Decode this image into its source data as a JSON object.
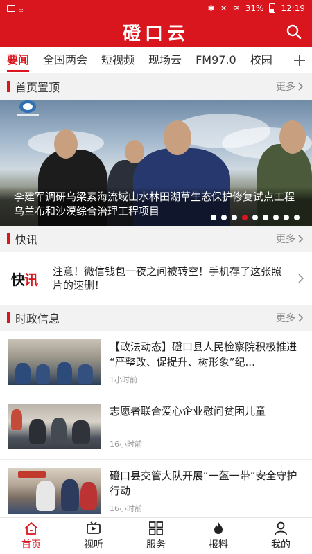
{
  "status_bar": {
    "battery": "31%",
    "time": "12:19"
  },
  "app": {
    "title": "磴口云"
  },
  "tabs": [
    {
      "label": "要闻",
      "active": true
    },
    {
      "label": "全国两会"
    },
    {
      "label": "短视频"
    },
    {
      "label": "现场云"
    },
    {
      "label": "FM97.0"
    },
    {
      "label": "校园"
    }
  ],
  "sections": {
    "top": {
      "title": "首页置顶",
      "more": "更多"
    },
    "flash": {
      "title": "快讯",
      "more": "更多"
    },
    "politics": {
      "title": "时政信息",
      "more": "更多"
    }
  },
  "banner": {
    "caption": "李建军调研乌梁素海流域山水林田湖草生态保护修复试点工程乌兰布和沙漠综合治理工程项目",
    "slide_count": 9,
    "active_slide": 4
  },
  "flash": {
    "badge_a": "快",
    "badge_b": "讯",
    "text": "注意！微信钱包一夜之间被转空！手机存了这张照片的速删！"
  },
  "news": [
    {
      "headline": "【政法动态】磴口县人民检察院积极推进 “严整改、促提升、树形象”纪...",
      "time": "1小时前"
    },
    {
      "headline": "志愿者联合爱心企业慰问贫困儿童",
      "time": "16小时前"
    },
    {
      "headline": "磴口县交管大队开展“一盔一带”安全守护行动",
      "time": "16小时前"
    }
  ],
  "bottom_nav": [
    {
      "label": "首页",
      "icon": "home-icon",
      "active": true
    },
    {
      "label": "视听",
      "icon": "tv-icon"
    },
    {
      "label": "服务",
      "icon": "grid-icon"
    },
    {
      "label": "报料",
      "icon": "fire-icon"
    },
    {
      "label": "我的",
      "icon": "user-icon"
    }
  ],
  "colors": {
    "brand": "#d9161e"
  }
}
